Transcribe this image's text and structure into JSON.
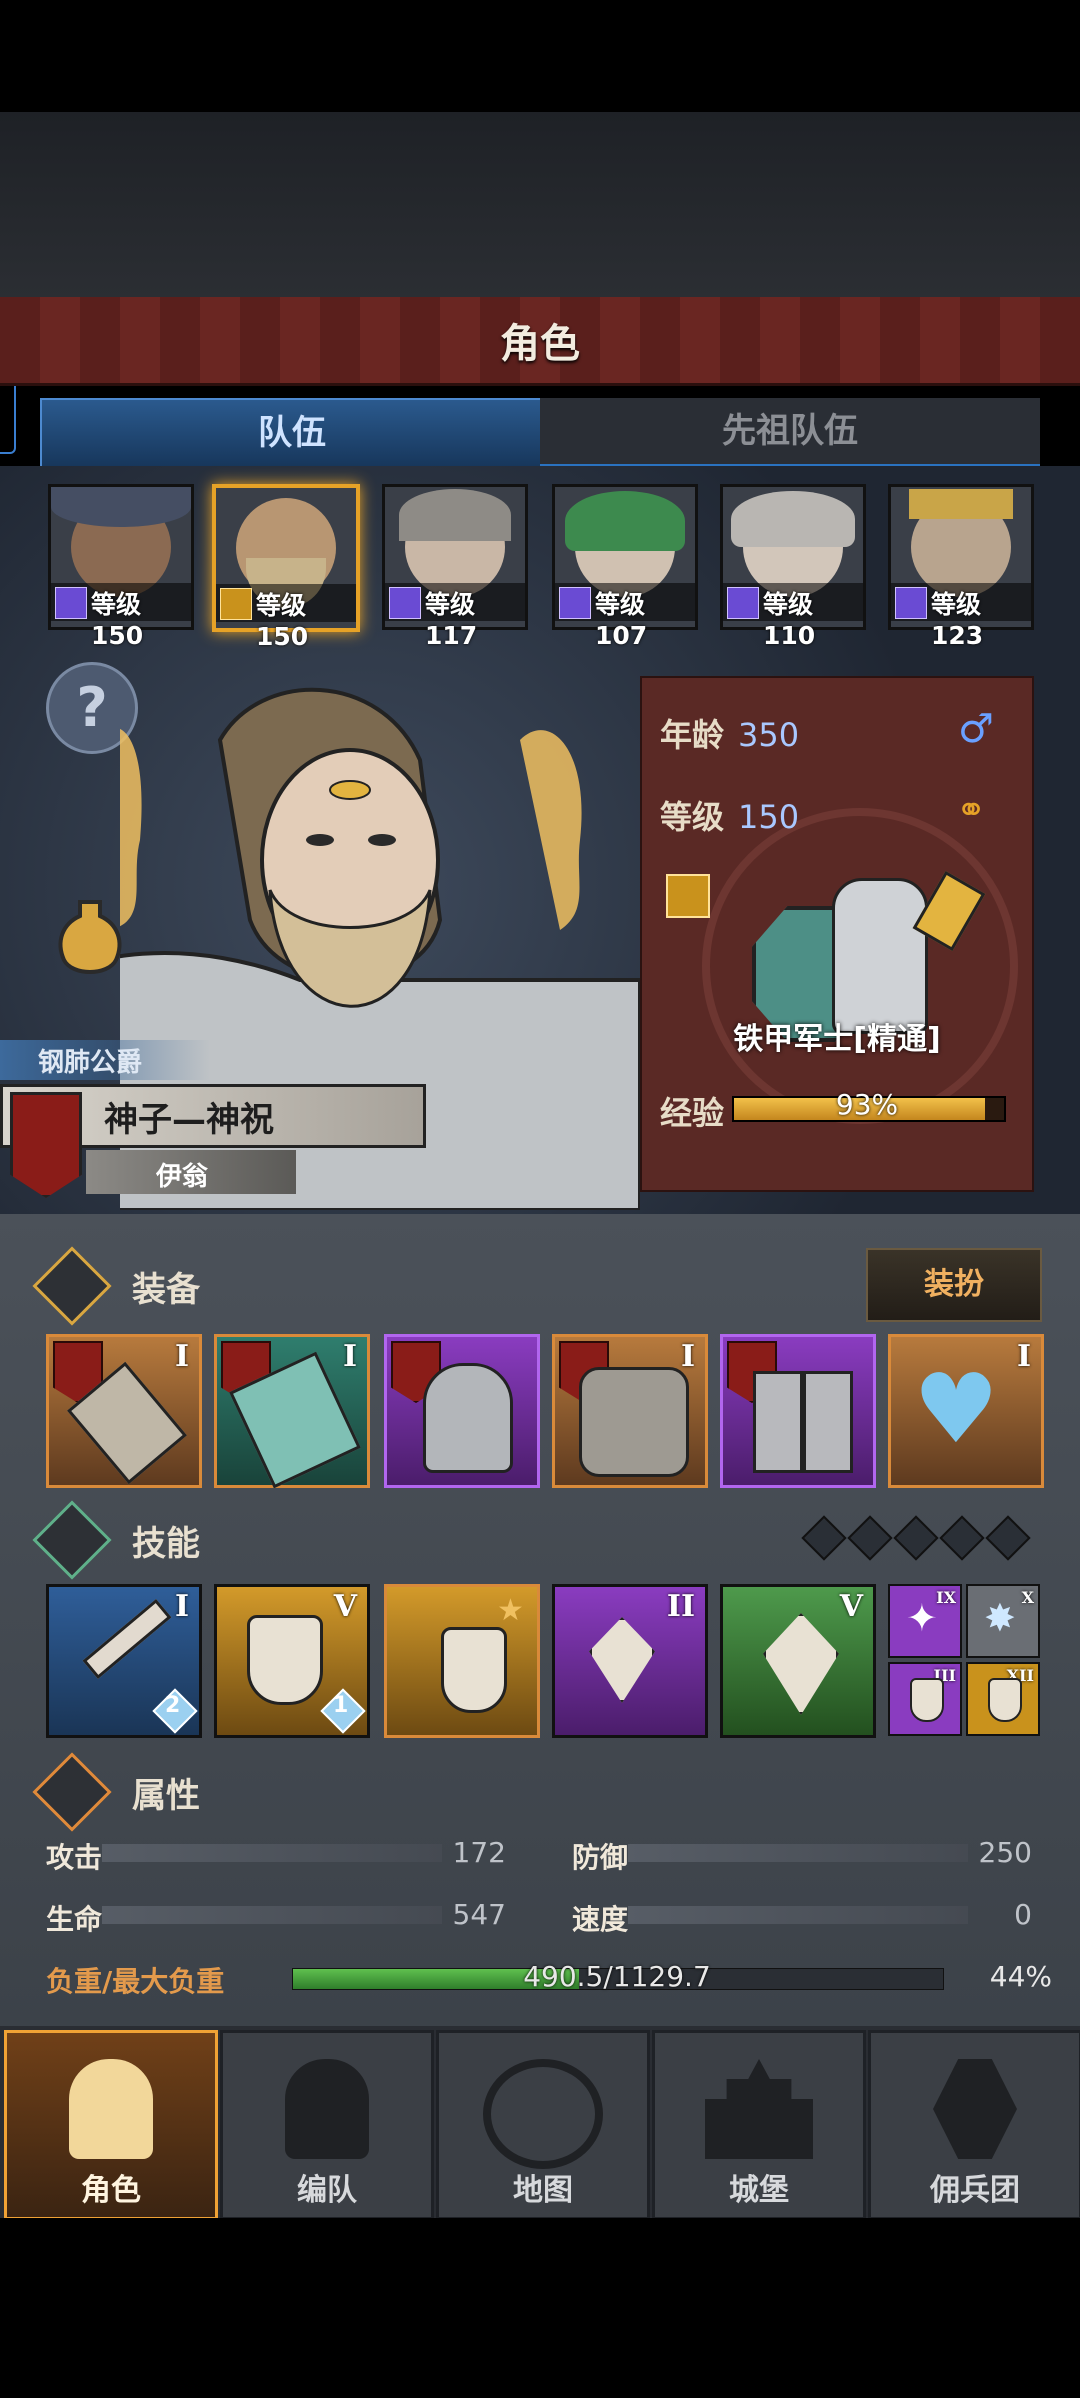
{
  "header": {
    "title": "角色"
  },
  "tabs": [
    {
      "label": "队伍",
      "active": true
    },
    {
      "label": "先祖队伍",
      "active": false
    }
  ],
  "team": [
    {
      "level": "等级150",
      "class": "sword",
      "selected": false
    },
    {
      "level": "等级150",
      "class": "shield",
      "selected": true
    },
    {
      "level": "等级117",
      "class": "staff",
      "selected": false
    },
    {
      "level": "等级107",
      "class": "staff",
      "selected": false
    },
    {
      "level": "等级110",
      "class": "staff",
      "selected": false
    },
    {
      "level": "等级123",
      "class": "staff",
      "selected": false
    }
  ],
  "character": {
    "noble_title": "钢肺公爵",
    "epithet": "神子—神祝万疆",
    "name": "伊翁",
    "age_label": "年龄",
    "age": "350",
    "level_label": "等级",
    "level": "150",
    "gender_icon": "male-icon",
    "marriage_icon": "rings-icon",
    "class_name": "铁甲军士[精通]",
    "exp_label": "经验",
    "exp_percent": "93%",
    "exp_fraction": 0.93
  },
  "equipment": {
    "title": "装备",
    "dress_button": "装扮",
    "slots": [
      {
        "name": "hammer",
        "rank": "I",
        "banner": true,
        "color": "orange"
      },
      {
        "name": "shield",
        "rank": "I",
        "banner": true,
        "color": "orange"
      },
      {
        "name": "helmet",
        "rank": "",
        "banner": true,
        "color": "purple"
      },
      {
        "name": "armor",
        "rank": "I",
        "banner": true,
        "color": "orange"
      },
      {
        "name": "boots",
        "rank": "",
        "banner": true,
        "color": "purple"
      },
      {
        "name": "amulet",
        "rank": "I",
        "banner": false,
        "color": "orange"
      }
    ]
  },
  "skills": {
    "title": "技能",
    "slots": [
      {
        "rank": "I",
        "badge": "2",
        "color": "blue"
      },
      {
        "rank": "V",
        "badge": "1",
        "color": "gold"
      },
      {
        "rank": "",
        "badge": "",
        "color": "gold"
      },
      {
        "rank": "II",
        "badge": "",
        "color": "purple"
      },
      {
        "rank": "V",
        "badge": "",
        "color": "green"
      }
    ],
    "passives": [
      {
        "rank": "IX",
        "color": "purple"
      },
      {
        "rank": "X",
        "color": "gray"
      },
      {
        "rank": "III",
        "color": "purple"
      },
      {
        "rank": "XII",
        "color": "gold"
      }
    ]
  },
  "attributes": {
    "title": "属性",
    "attack_label": "攻击",
    "attack": "172",
    "defense_label": "防御",
    "defense": "250",
    "hp_label": "生命",
    "hp": "547",
    "speed_label": "速度",
    "speed": "0",
    "load_label": "负重/最大负重",
    "load": "490.5/1129.7",
    "load_percent": "44%",
    "load_fraction": 0.44
  },
  "nav": [
    {
      "label": "角色",
      "active": true
    },
    {
      "label": "编队",
      "active": false
    },
    {
      "label": "地图",
      "active": false
    },
    {
      "label": "城堡",
      "active": false
    },
    {
      "label": "佣兵团",
      "active": false
    }
  ],
  "colors": {
    "accent": "#e6a227",
    "tab_active": "#2b5a8e",
    "panel": "#5a2925"
  }
}
